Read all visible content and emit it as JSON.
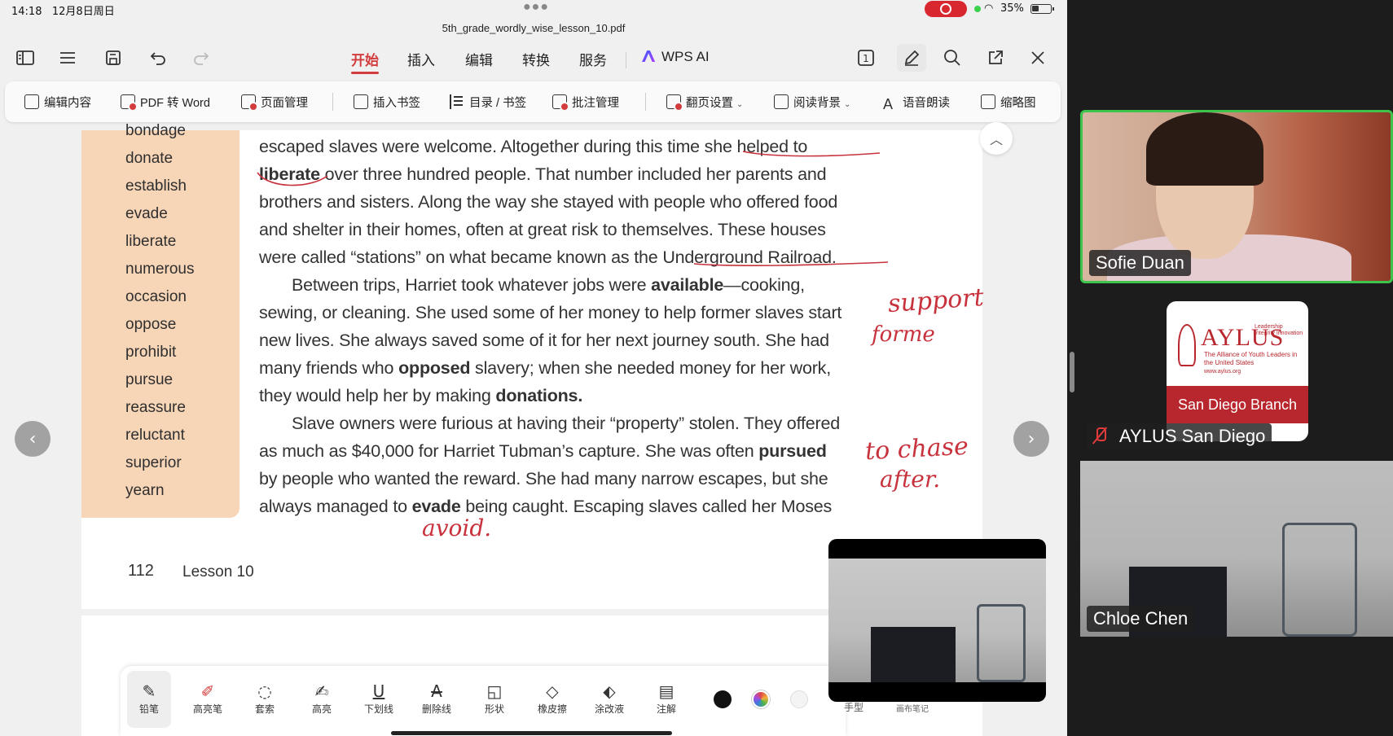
{
  "status_bar": {
    "time": "14:18",
    "date": "12月8日周日",
    "battery": "35%"
  },
  "document": {
    "filename": "5th_grade_wordly_wise_lesson_10.pdf"
  },
  "menu_tabs": [
    {
      "label": "开始",
      "active": true
    },
    {
      "label": "插入",
      "active": false
    },
    {
      "label": "编辑",
      "active": false
    },
    {
      "label": "转换",
      "active": false
    },
    {
      "label": "服务",
      "active": false
    }
  ],
  "wps_ai_label": "WPS AI",
  "right_icons": {
    "page_badge": "1"
  },
  "toolbar": [
    {
      "label": "编辑内容",
      "icon": "edit-icon"
    },
    {
      "label": "PDF 转 Word",
      "icon": "convert-icon"
    },
    {
      "label": "页面管理",
      "icon": "pages-icon"
    },
    {
      "label": "插入书签",
      "icon": "bookmark-icon"
    },
    {
      "label": "目录 / 书签",
      "icon": "toc-icon"
    },
    {
      "label": "批注管理",
      "icon": "annotations-icon"
    },
    {
      "label": "翻页设置",
      "icon": "page-turn-icon"
    },
    {
      "label": "阅读背景",
      "icon": "background-icon"
    },
    {
      "label": "语音朗读",
      "icon": "read-aloud-icon"
    },
    {
      "label": "缩略图",
      "icon": "thumbnail-icon"
    }
  ],
  "vocab": [
    "bondage",
    "donate",
    "establish",
    "evade",
    "liberate",
    "numerous",
    "occasion",
    "oppose",
    "prohibit",
    "pursue",
    "reassure",
    "reluctant",
    "superior",
    "yearn"
  ],
  "passage": {
    "l1": "escaped slaves were welcome. Altogether during this time she helped to",
    "l2_b": "liberate",
    "l2": " over three hundred people. That number included her parents and",
    "l3": "brothers and sisters. Along the way she stayed with people who offered food",
    "l4": "and shelter in their homes, often at great risk to themselves. These houses",
    "l5": "were called “stations” on what became known as the Underground Railroad.",
    "l6_a": "Between trips, Harriet took whatever jobs were ",
    "l6_b": "available",
    "l6_c": "—cooking,",
    "l7": "sewing, or cleaning. She used some of her money to help former slaves start",
    "l8": "new lives. She always saved some of it for her next journey south. She had",
    "l9_a": "many friends who ",
    "l9_b": "opposed",
    "l9_c": " slavery; when she needed money for her work,",
    "l10_a": "they would help her by making ",
    "l10_b": "donations.",
    "l11": "Slave owners were furious at having their “property” stolen. They offered",
    "l12_a": "as much as $40,000 for Harriet Tubman’s capture. She was often ",
    "l12_b": "pursued",
    "l13": "by people who wanted the reward. She had many narrow escapes, but she",
    "l14_a": "always managed to ",
    "l14_b": "evade",
    "l14_c": " being caught. Escaping slaves called her Moses"
  },
  "page_footer": {
    "number": "112",
    "lesson": "Lesson 10"
  },
  "handwriting": {
    "support": "support",
    "forme": "forme",
    "chase": "to chase",
    "after": "after.",
    "avoid": "avoid."
  },
  "annotation_tools": [
    {
      "label": "铅笔",
      "icon": "pencil-icon"
    },
    {
      "label": "高亮笔",
      "icon": "highlighter-pen-icon"
    },
    {
      "label": "套索",
      "icon": "lasso-icon"
    },
    {
      "label": "高亮",
      "icon": "highlight-icon"
    },
    {
      "label": "下划线",
      "icon": "underline-icon"
    },
    {
      "label": "删除线",
      "icon": "strikethrough-icon"
    },
    {
      "label": "形状",
      "icon": "shape-icon"
    },
    {
      "label": "橡皮擦",
      "icon": "eraser-icon"
    },
    {
      "label": "涂改液",
      "icon": "correction-fluid-icon"
    },
    {
      "label": "注解",
      "icon": "comment-icon"
    }
  ],
  "colors": {
    "black": "#111111",
    "multi": "#e04848",
    "pencil_red": "#c8323c",
    "accent": "#d33c3c",
    "speaker_green": "#3ec44c"
  },
  "annotation_extra": {
    "hand_type": "手型",
    "canvas_note": "画布笔记"
  },
  "participants": [
    {
      "name": "Sofie Duan"
    },
    {
      "name": "AYLUS San Diego",
      "muted": true
    },
    {
      "name": "Chloe Chen"
    }
  ],
  "aylus_card": {
    "brand": "AYLUS",
    "tagline": "Leadership Integrity Innovation",
    "full_name": "The Alliance of Youth Leaders in the United States",
    "url": "www.aylus.org",
    "branch": "San Diego Branch"
  }
}
